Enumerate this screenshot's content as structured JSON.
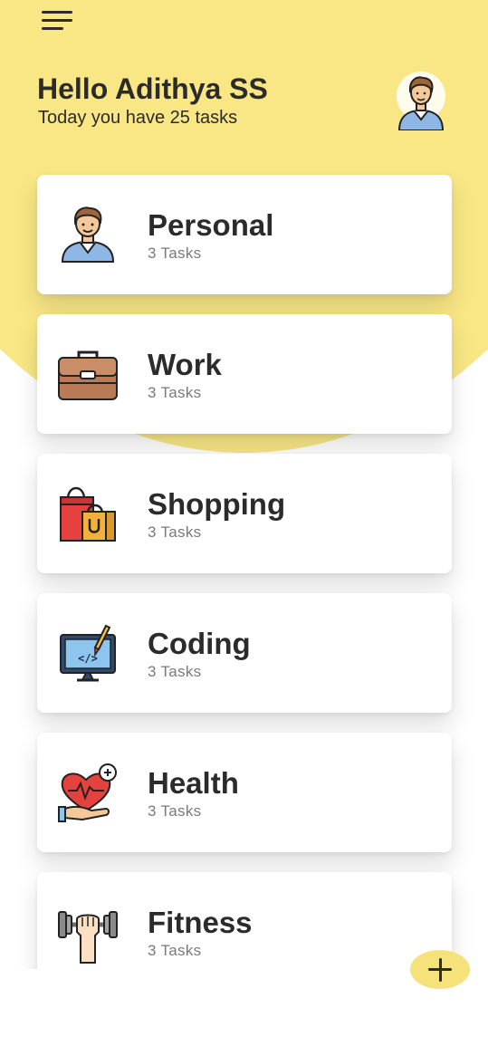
{
  "header": {
    "menu_icon": "hamburger-menu-icon",
    "greeting": "Hello Adithya SS",
    "subtitle": "Today you have 25 tasks",
    "avatar_icon": "user-avatar-icon"
  },
  "categories": [
    {
      "name": "Personal",
      "count": "3 Tasks",
      "icon": "person-icon"
    },
    {
      "name": "Work",
      "count": "3 Tasks",
      "icon": "briefcase-icon"
    },
    {
      "name": "Shopping",
      "count": "3 Tasks",
      "icon": "shopping-bags-icon"
    },
    {
      "name": "Coding",
      "count": "3 Tasks",
      "icon": "monitor-code-icon"
    },
    {
      "name": "Health",
      "count": "3 Tasks",
      "icon": "heart-hand-icon"
    },
    {
      "name": "Fitness",
      "count": "3 Tasks",
      "icon": "dumbbell-icon"
    }
  ],
  "fab": {
    "icon": "plus-icon"
  },
  "colors": {
    "accent_yellow": "#f9e785",
    "fab_yellow": "#f6e27a",
    "text_dark": "#2b2b2b",
    "text_muted": "#7a7a7a"
  }
}
